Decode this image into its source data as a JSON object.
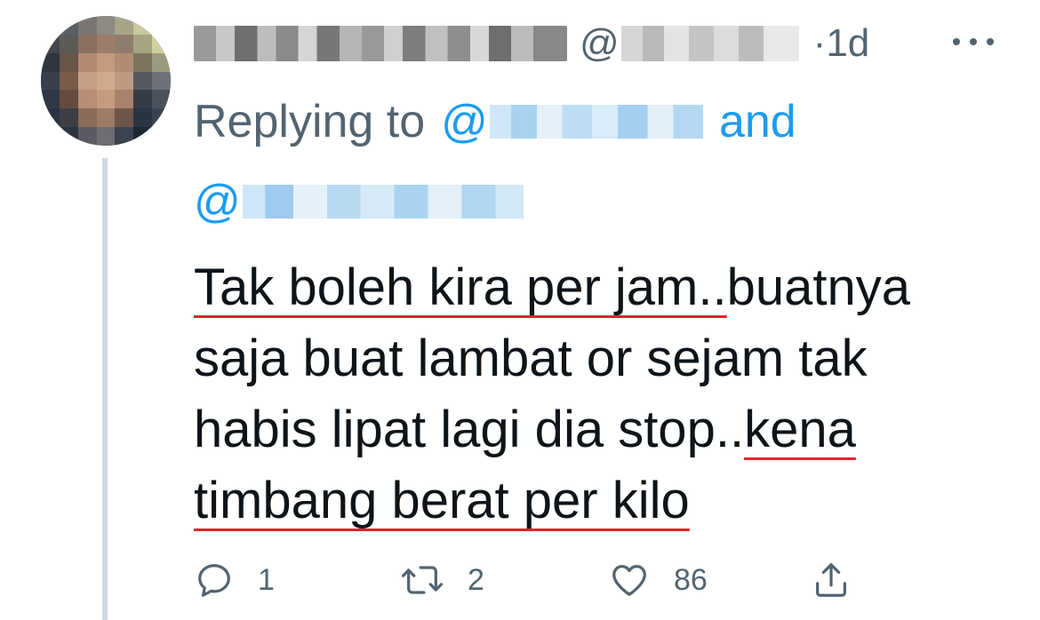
{
  "tweet": {
    "handle_prefix": "@",
    "time": "·1d",
    "reply_prefix": "Replying to",
    "reply_at_1": "@",
    "reply_and": "and",
    "reply_at_2": "@",
    "body": {
      "line1_a": "Tak boleh kira per jam..",
      "line1_b": "buatnya",
      "line2": "saja buat lambat or sejam tak",
      "line3_a": "habis lipat lagi dia stop..",
      "line3_b": "kena",
      "line4": "timbang berat per kilo"
    },
    "underline_color": "#e0242c",
    "actions": {
      "reply_count": "1",
      "retweet_count": "2",
      "like_count": "86"
    },
    "icons": {
      "reply": "reply-icon",
      "retweet": "retweet-icon",
      "like": "heart-icon",
      "share": "share-icon",
      "more": "more-icon"
    },
    "colors": {
      "link": "#1d9bf0",
      "secondary": "#536471",
      "text": "#0f1419",
      "thread_line": "#cfd9de"
    }
  }
}
